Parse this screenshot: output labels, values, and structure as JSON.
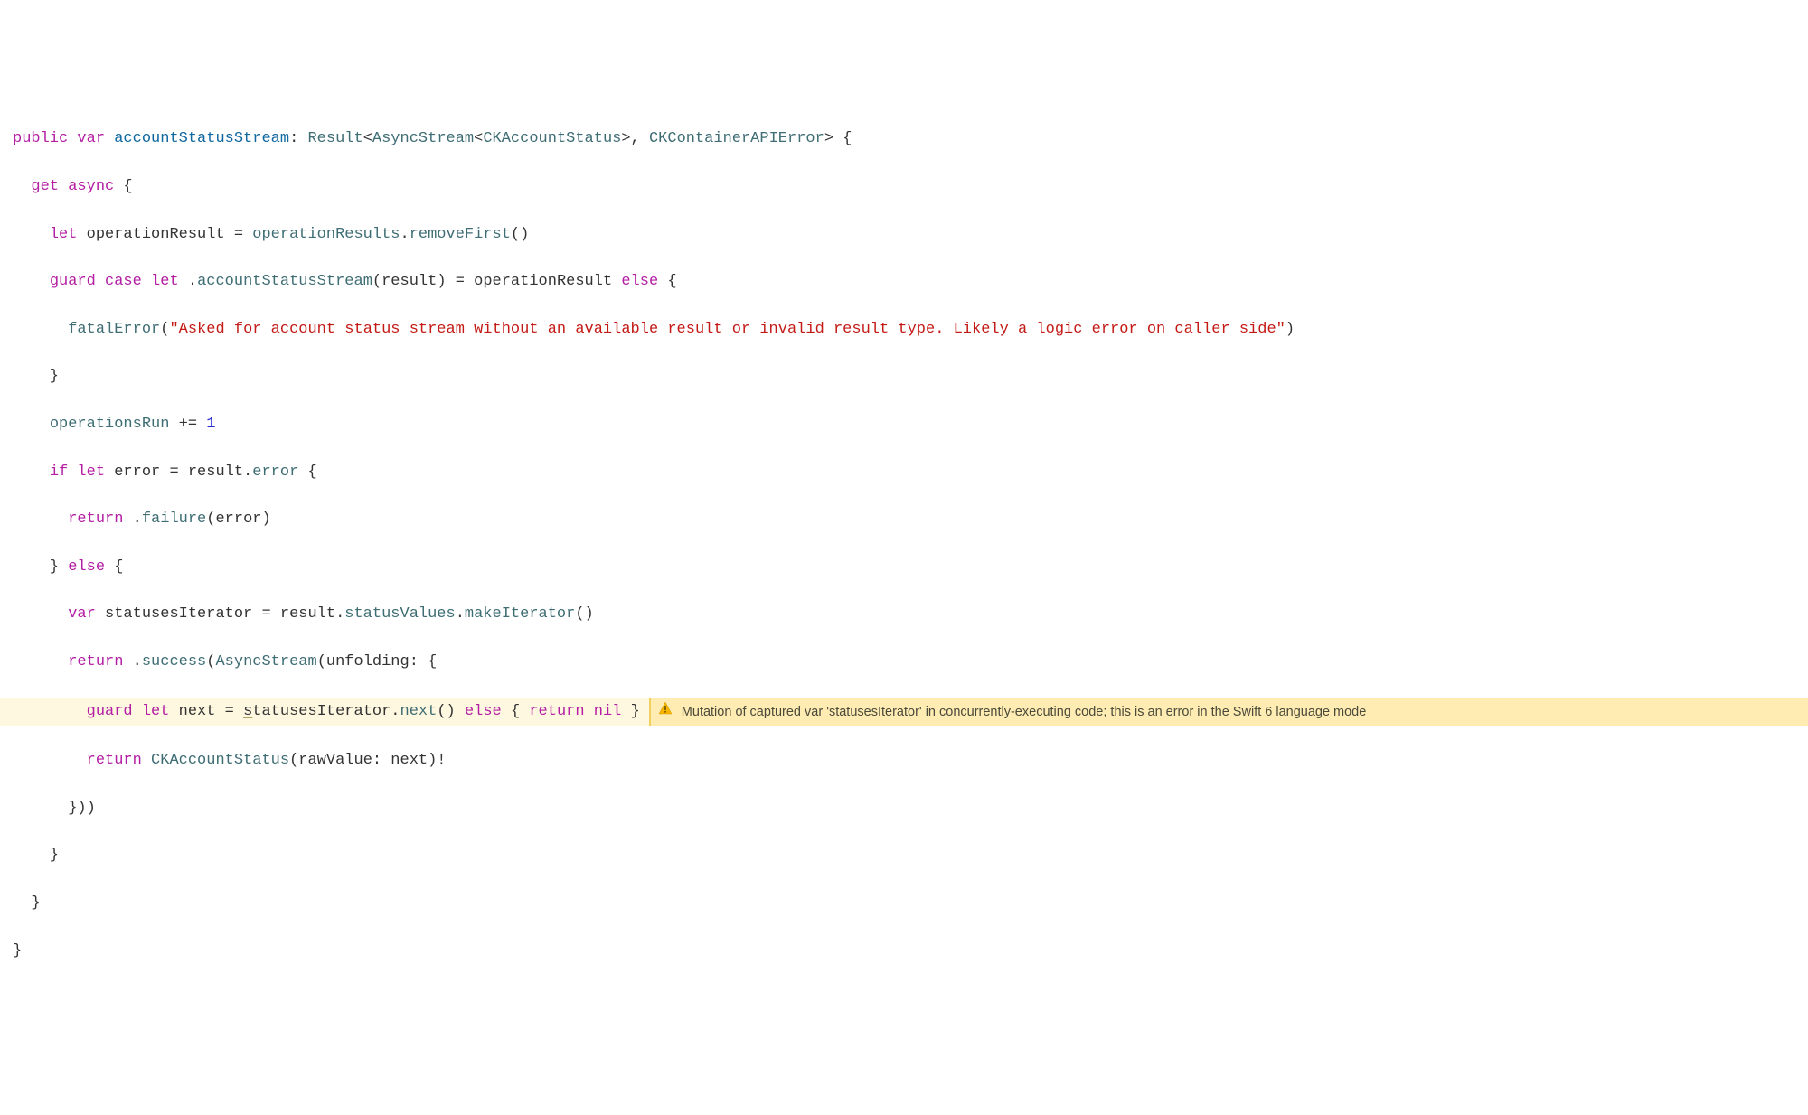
{
  "code": {
    "l1": {
      "k_public": "public",
      "k_var": "var",
      "name": "accountStatusStream",
      "colon": ": ",
      "t_result": "Result",
      "lt1": "<",
      "t_asyncstream": "AsyncStream",
      "lt2": "<",
      "t_ckaccount": "CKAccountStatus",
      "gt1": ">, ",
      "t_error": "CKContainerAPIError",
      "gt2": "> {"
    },
    "l2": {
      "indent": "  ",
      "k_get": "get",
      "sp": " ",
      "k_async": "async",
      "brace": " {"
    },
    "l3": {
      "indent": "    ",
      "k_let": "let",
      "sp": " operationResult = ",
      "m1": "operationResults",
      "dot": ".",
      "m2": "removeFirst",
      "paren": "()"
    },
    "l4": {
      "indent": "    ",
      "k_guard": "guard",
      "sp1": " ",
      "k_case": "case",
      "sp2": " ",
      "k_let": "let",
      "sp3": " .",
      "enum_case": "accountStatusStream",
      "paren": "(result) = operationResult ",
      "k_else": "else",
      "brace": " {"
    },
    "l5": {
      "indent": "      ",
      "fn": "fatalError",
      "paren_open": "(",
      "str": "\"Asked for account status stream without an available result or invalid result type. Likely a logic error on caller side\"",
      "paren_close": ")"
    },
    "l6": {
      "indent": "    }",
      "text": ""
    },
    "l7": {
      "indent": "    ",
      "m1": "operationsRun",
      "op": " += ",
      "num": "1"
    },
    "l8": {
      "indent": "    ",
      "k_if": "if",
      "sp1": " ",
      "k_let": "let",
      "sp2": " error = result.",
      "m1": "error",
      "brace": " {"
    },
    "l9": {
      "indent": "      ",
      "k_return": "return",
      "sp": " .",
      "m1": "failure",
      "paren": "(error)"
    },
    "l10": {
      "indent": "    } ",
      "k_else": "else",
      "brace": " {"
    },
    "l11": {
      "indent": "      ",
      "k_var": "var",
      "sp": " statusesIterator = result.",
      "m1": "statusValues",
      "dot": ".",
      "m2": "makeIterator",
      "paren": "()"
    },
    "l12": {
      "indent": "      ",
      "k_return": "return",
      "sp": " .",
      "m1": "success",
      "paren_open": "(",
      "t1": "AsyncStream",
      "paren2": "(unfolding: {"
    },
    "l13": {
      "indent": "        ",
      "k_guard": "guard",
      "sp1": " ",
      "k_let": "let",
      "sp2": " next = ",
      "underlined_s": "s",
      "rest_var": "tatusesIterator.",
      "m1": "next",
      "paren": "() ",
      "k_else": "else",
      "brace": " { ",
      "k_return": "return",
      "sp3": " ",
      "k_nil": "nil",
      "brace2": " }"
    },
    "l14": {
      "indent": "        ",
      "k_return": "return",
      "sp": " ",
      "t1": "CKAccountStatus",
      "paren": "(rawValue: next)!"
    },
    "l15": {
      "text": "      }))"
    },
    "l16": {
      "text": "    }"
    },
    "l17": {
      "text": "  }"
    },
    "l18": {
      "text": "}"
    }
  },
  "warning": {
    "message": "Mutation of captured var 'statusesIterator' in concurrently-executing code; this is an error in the Swift 6 language mode"
  }
}
